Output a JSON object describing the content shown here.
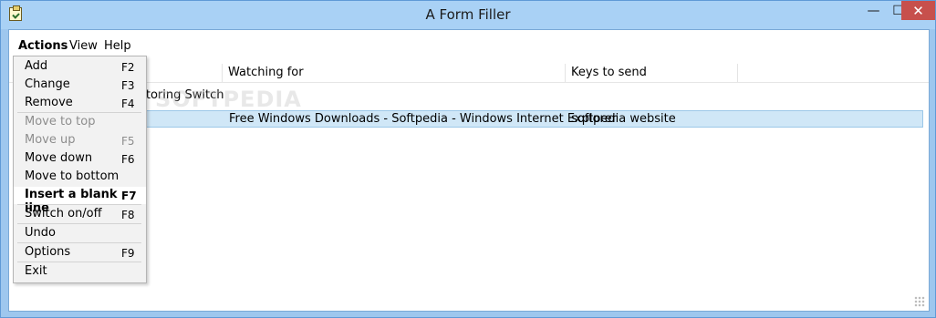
{
  "window": {
    "title": "A Form Filler",
    "minimize_glyph": "—",
    "maximize_glyph": "☐",
    "close_glyph": "✕"
  },
  "menubar": {
    "actions": "Actions",
    "view": "View",
    "help": "Help"
  },
  "list": {
    "headers": {
      "watching_for": "Watching for",
      "keys_to_send": "Keys to send"
    },
    "group_label": "nitoring Switch",
    "rows": [
      {
        "watching_for": "Free Windows Downloads - Softpedia - Windows Internet Explorer",
        "keys_to_send": "softpedia website"
      }
    ]
  },
  "watermark": "SOFTPEDIA",
  "actions_menu": {
    "items": [
      {
        "label": "Add",
        "key": "F2",
        "enabled": true
      },
      {
        "label": "Change",
        "key": "F3",
        "enabled": true
      },
      {
        "label": "Remove",
        "key": "F4",
        "enabled": true
      },
      {
        "label": "Move to top",
        "key": "",
        "enabled": false
      },
      {
        "label": "Move up",
        "key": "F5",
        "enabled": false
      },
      {
        "label": "Move down",
        "key": "F6",
        "enabled": true
      },
      {
        "label": "Move to bottom",
        "key": "",
        "enabled": true
      },
      {
        "label": "Insert a blank line",
        "key": "F7",
        "enabled": true
      },
      {
        "label": "Switch on/off",
        "key": "F8",
        "enabled": true
      },
      {
        "label": "Undo",
        "key": "",
        "enabled": true
      },
      {
        "label": "Options",
        "key": "F9",
        "enabled": true
      },
      {
        "label": "Exit",
        "key": "",
        "enabled": true
      }
    ]
  },
  "colors": {
    "titlebar": "#a9d1f5",
    "close_button": "#c7504c",
    "selection": "#d0e7f7"
  }
}
